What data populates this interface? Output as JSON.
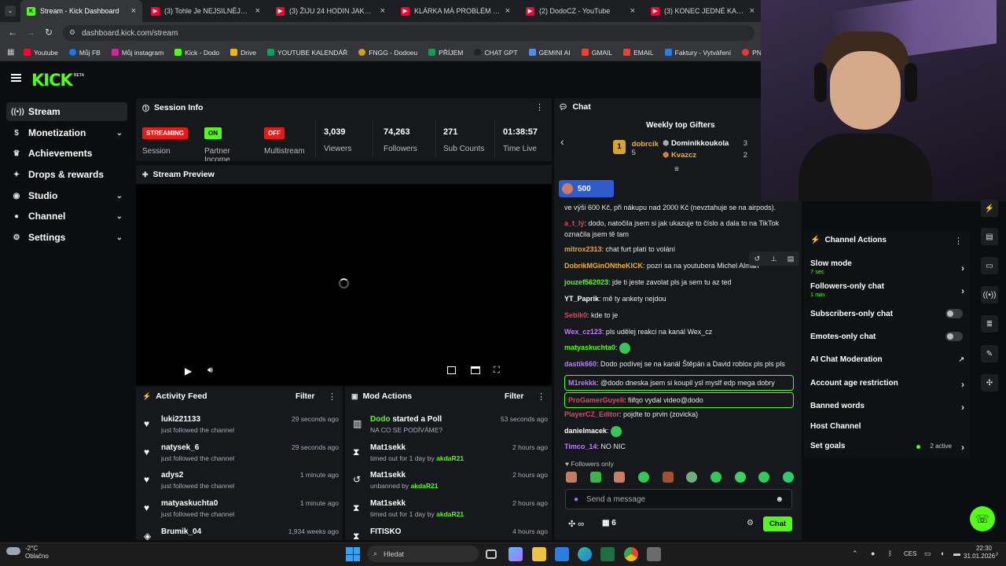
{
  "browser": {
    "tabs": [
      {
        "label": "Stream - Kick Dashboard",
        "active": true
      },
      {
        "label": "(3) Tohle Je NEJSILNĚJŠÍ DÍTĚ v"
      },
      {
        "label": "(3) ŽIJU 24 HODIN JAKO @Real"
      },
      {
        "label": "KLÁRKA MÁ PROBLÉM - YouTu"
      },
      {
        "label": "(2) DodoCZ - YouTube"
      },
      {
        "label": "(3) KONEC JEDNÉ KAPITOLY. D"
      }
    ],
    "url": "dashboard.kick.com/stream",
    "bookmarks": [
      "Youtube",
      "Můj FB",
      "Můj instagram",
      "Kick - Dodo",
      "Drive",
      "YOUTUBE KALENDÁŘ",
      "FNGG - Dodoeu",
      "PŘÍJEM",
      "CHAT GPT",
      "GEMINI AI",
      "GMAIL",
      "EMAIL",
      "Faktury - Vytváření",
      "PNG to PDF"
    ]
  },
  "app": {
    "logo": "KICK",
    "logo_badge": "BETA",
    "nav": [
      {
        "label": "Stream",
        "icon": "stream-icon",
        "active": true
      },
      {
        "label": "Monetization",
        "icon": "dollar-icon",
        "chevron": true
      },
      {
        "label": "Achievements",
        "icon": "trophy-icon"
      },
      {
        "label": "Drops & rewards",
        "icon": "gift-icon"
      },
      {
        "label": "Studio",
        "icon": "studio-icon",
        "chevron": true
      },
      {
        "label": "Channel",
        "icon": "person-icon",
        "chevron": true
      },
      {
        "label": "Settings",
        "icon": "gear-icon",
        "chevron": true
      }
    ]
  },
  "session_info": {
    "title": "Session Info",
    "session_badge": "STREAMING",
    "session_label": "Session",
    "partner_badge": "ON",
    "partner_label": "Partner Income",
    "multistream_badge": "OFF",
    "multistream_label": "Multistream",
    "viewers": "3,039",
    "viewers_label": "Viewers",
    "followers": "74,263",
    "followers_label": "Followers",
    "subs": "271",
    "subs_label": "Sub Counts",
    "time": "01:38:57",
    "time_label": "Time Live"
  },
  "stream_preview": {
    "title": "Stream Preview"
  },
  "activity_feed": {
    "title": "Activity Feed",
    "filter": "Filter",
    "items": [
      {
        "name": "luki221133",
        "sub": "just followed the channel",
        "time": "29 seconds ago"
      },
      {
        "name": "natysek_6",
        "sub": "just followed the channel",
        "time": "29 seconds ago"
      },
      {
        "name": "adys2",
        "sub": "just followed the channel",
        "time": "1 minute ago"
      },
      {
        "name": "matyaskuchta0",
        "sub": "just followed the channel",
        "time": "1 minute ago"
      },
      {
        "name": "Brumik_04",
        "sub": "",
        "time": "1,934 weeks ago"
      }
    ]
  },
  "mod_actions": {
    "title": "Mod Actions",
    "filter": "Filter",
    "items": [
      {
        "name": "Dodo",
        "action": " started a Poll",
        "sub": "NA CO SE PODÍVÁME?",
        "by": "",
        "time": "53 seconds ago",
        "icon": "poll-icon"
      },
      {
        "name": "Mat1sekk",
        "action": "",
        "sub": "timed out for 1 day by ",
        "by": "akdaR21",
        "time": "2 hours ago",
        "icon": "hourglass-icon"
      },
      {
        "name": "Mat1sekk",
        "action": "",
        "sub": "unbanned by ",
        "by": "akdaR21",
        "time": "2 hours ago",
        "icon": "unban-icon"
      },
      {
        "name": "Mat1sekk",
        "action": "",
        "sub": "timed out for 1 day by ",
        "by": "akdaR21",
        "time": "2 hours ago",
        "icon": "hourglass-icon"
      },
      {
        "name": "FITISKO",
        "action": "",
        "sub": "",
        "by": "",
        "time": "4 hours ago",
        "icon": "hourglass-icon"
      }
    ]
  },
  "chat": {
    "title": "Chat",
    "gifters_title": "Weekly top Gifters",
    "gifters": [
      {
        "name": "dobrcik",
        "count": "5"
      },
      {
        "name": "Dominikkoukola",
        "count": "3"
      },
      {
        "name": "Kvazcz",
        "count": "2"
      }
    ],
    "pinned_amount": "500",
    "messages": [
      {
        "user": "",
        "text": "ve výši 600 Kč, při nákupu nad 2000 Kč (nevztahuje se na airpods).",
        "color": "#e8e8e8"
      },
      {
        "user": "a_t_lý",
        "text": "dodo, natočila jsem si jak ukazuje to číslo a dala to na TikTok označila jsem tě tam",
        "color": "#e0475a"
      },
      {
        "user": "mitrox2313",
        "text": "chat furt platí to volání",
        "color": "#f0a030"
      },
      {
        "user": "DobrikMGinONtheKICK",
        "text": "pozri sa na youtubera Michel Alman",
        "color": "#f0b030"
      },
      {
        "user": "jouzef562023",
        "text": "jde ti jeste zavolat pls ja sem tu az ted",
        "color": "#53fc18"
      },
      {
        "user": "YT_Paprik",
        "text": "mě ty ankety nejdou",
        "color": "#ffffff"
      },
      {
        "user": "Sebik0",
        "text": "kde to je",
        "color": "#e0475a"
      },
      {
        "user": "Wex_cz123",
        "text": "pls udělej reakci na kanál Wex_cz",
        "color": "#c07bff"
      },
      {
        "user": "matyaskuchta0",
        "text": "",
        "color": "#53fc18"
      },
      {
        "user": "dastik660",
        "text": "Dodo podívej se na kanál Štěpán a David roblox pls pls pls",
        "color": "#c07bff"
      },
      {
        "user": "M1rekkk",
        "text": "@dodo dneska jsem si koupil ysl myslf edp mega dobry",
        "color": "#c07bff",
        "highlight": true
      },
      {
        "user": "ProGamerGuyeli",
        "text": "fiifqo vydal video@dodo",
        "color": "#e0475a",
        "highlight": true
      },
      {
        "user": "PlayerCZ_Editor",
        "text": "pojdte to prvin (zovicka)",
        "color": "#e0475a"
      },
      {
        "user": "danielmacek",
        "text": "",
        "color": "#ffffff"
      },
      {
        "user": "Timco_14",
        "text": "NO NIC",
        "color": "#c07bff"
      }
    ],
    "followers_only": "Followers only",
    "input_placeholder": "Send a message",
    "points": "∞",
    "gift_count": "6",
    "send_label": "Chat"
  },
  "channel_actions": {
    "title": "Channel Actions",
    "items": [
      {
        "label": "Slow mode",
        "sub": "7 sec",
        "type": "arrow"
      },
      {
        "label": "Followers-only chat",
        "sub": "1 min",
        "type": "arrow"
      },
      {
        "label": "Subscribers-only chat",
        "sub": "",
        "type": "toggle"
      },
      {
        "label": "Emotes-only chat",
        "sub": "",
        "type": "toggle"
      },
      {
        "label": "AI Chat Moderation",
        "sub": "",
        "type": "external"
      },
      {
        "label": "Account age restriction",
        "sub": "",
        "type": "arrow"
      },
      {
        "label": "Banned words",
        "sub": "",
        "type": "arrow"
      },
      {
        "label": "Host Channel",
        "sub": "",
        "type": "none"
      },
      {
        "label": "Set goals",
        "sub": "",
        "type": "arrow",
        "badge": "2 active"
      }
    ]
  },
  "taskbar": {
    "weather_temp": "-2°C",
    "weather_desc": "Oblačno",
    "search_placeholder": "Hledat",
    "lang": "CES",
    "time": "22:30",
    "date": "31.01.2026"
  },
  "colors": {
    "accent": "#53fc18",
    "live": "#e91916",
    "panel": "#16191b"
  }
}
